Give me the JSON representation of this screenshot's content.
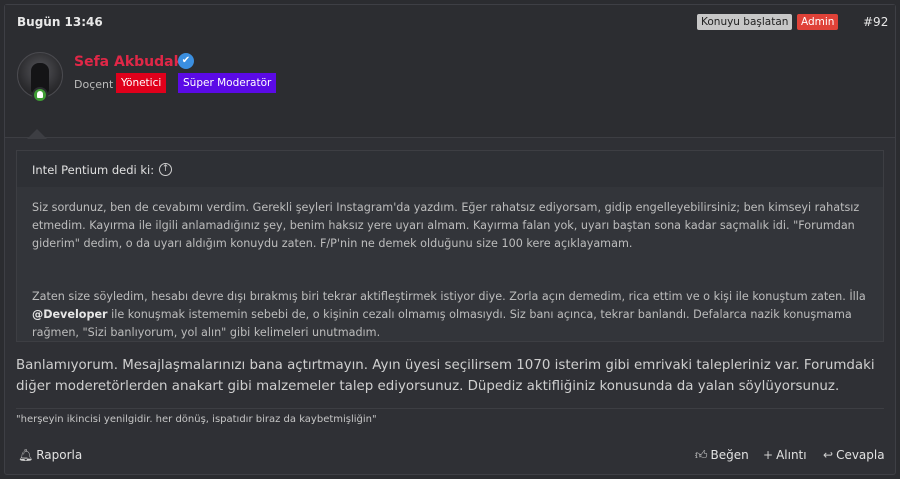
{
  "post": {
    "date": "Bugün 13:46",
    "starter_badge": "Konuyu başlatan",
    "admin_badge": "Admin",
    "post_number": "#92"
  },
  "author": {
    "name": "Sefa Akbudak",
    "title": "Doçent",
    "roles": [
      "Yönetici",
      "Süper Moderatör"
    ],
    "verified_icon": "verified-check-icon",
    "online_icon": "online-status-icon",
    "name_color": "#e02747",
    "role_colors": [
      "#e0001b",
      "#5b0ae6"
    ]
  },
  "quote": {
    "author": "Intel Pentium dedi ki:",
    "jump_icon": "arrow-up-circle-icon",
    "p1": "Siz sordunuz, ben de cevabımı verdim. Gerekli şeyleri Instagram'da yazdım. Eğer rahatsız ediyorsam, gidip engelleyebilirsiniz; ben kimseyi rahatsız etmedim. Kayırma ile ilgili anlamadığınız şey, benim haksız yere uyarı almam. Kayırma falan yok, uyarı baştan sona kadar saçmalık idi. \"Forumdan giderim\" dedim, o da uyarı aldığım konuydu zaten. F/P'nin ne demek olduğunu size 100 kere açıklayamam.",
    "p2_before": "Zaten size söyledim, hesabı devre dışı bırakmış biri tekrar aktifleştirmek istiyor diye. Zorla açın demedim, rica ettim ve o kişi ile konuştum zaten. İlla",
    "mention": "@Developer",
    "p2_after": " ile konuşmak istememin sebebi de, o kişinin cezalı olmamış olmasıydı. Siz banı açınca, tekrar banlandı. Defalarca nazik konuşmama rağmen, \"Sizi banlıyorum, yol alın\" gibi kelimeleri unutmadım."
  },
  "message": "Banlamıyorum. Mesajlaşmalarınızı bana açtırtmayın. Ayın üyesi seçilirsem 1070 isterim gibi emrivaki talepleriniz var. Forumdaki diğer moderetörlerden anakart gibi malzemeler talep ediyorsunuz. Düpediz aktifliğiniz konusunda da yalan söylüyorsunuz.",
  "signature": "\"herşeyin ikincisi yenilgidir. her dönüş, ispatıdır biraz da kaybetmişliğin\"",
  "actions": {
    "report": "Raporla",
    "like": "Beğen",
    "quote": "Alıntı",
    "reply": "Cevapla"
  }
}
